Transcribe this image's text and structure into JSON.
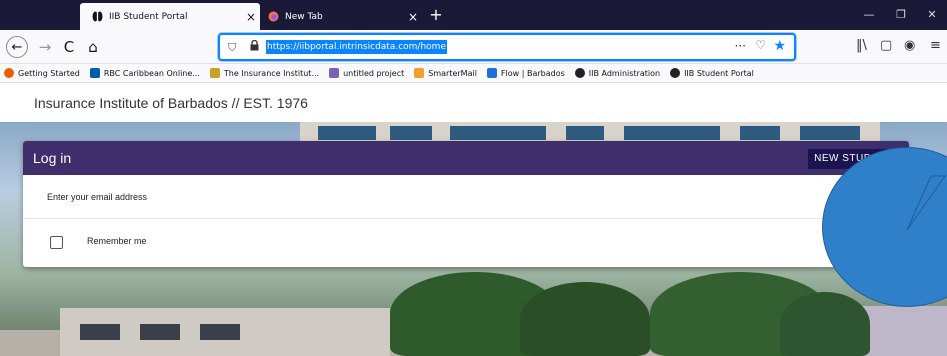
{
  "browser": {
    "tabs": [
      {
        "label": "IIB Student Portal",
        "active": true,
        "close": "×"
      },
      {
        "label": "New Tab",
        "active": false,
        "close": "×"
      }
    ],
    "new_tab": "+",
    "window_controls": {
      "minimize": "—",
      "restore": "❐",
      "close": "✕"
    },
    "nav": {
      "back": "←",
      "forward": "→",
      "reload": "C",
      "home": "⌂"
    },
    "url": "https://iibportal.intrinsicdata.com/home",
    "url_actions": {
      "more": "···",
      "pocket": "♡",
      "star": "★"
    },
    "toolbar_icons": {
      "library": "‖\\",
      "sidebar": "▢",
      "account": "◉",
      "menu": "≡"
    }
  },
  "bookmarks": [
    {
      "label": "Getting Started",
      "icon": "firefox-icon",
      "color": "#e66000"
    },
    {
      "label": "RBC Caribbean Online...",
      "icon": "rbc-icon",
      "color": "#005daa"
    },
    {
      "label": "The Insurance Institut...",
      "icon": "insurance-icon",
      "color": "#c9a227"
    },
    {
      "label": "untitled project",
      "icon": "project-icon",
      "color": "#7b5fb8"
    },
    {
      "label": "SmarterMail",
      "icon": "mail-icon",
      "color": "#f0a030"
    },
    {
      "label": "Flow | Barbados",
      "icon": "flow-icon",
      "color": "#1e6fd9"
    },
    {
      "label": "IIB Administration",
      "icon": "iib-icon",
      "color": "#222222"
    },
    {
      "label": "IIB Student Portal",
      "icon": "iib-icon",
      "color": "#222222"
    }
  ],
  "site": {
    "title": "Insurance Institute of Barbados // EST. 1976"
  },
  "login": {
    "title": "Log in",
    "new_student": "NEW STUDENT",
    "email_placeholder": "Enter your email address",
    "submit_icon": "→",
    "remember_label": "Remember me"
  },
  "colors": {
    "header": "#3e2e6b",
    "new_student_bg": "#1b1450",
    "submit": "#7b5fb8",
    "callout": "#2f7fc9"
  }
}
